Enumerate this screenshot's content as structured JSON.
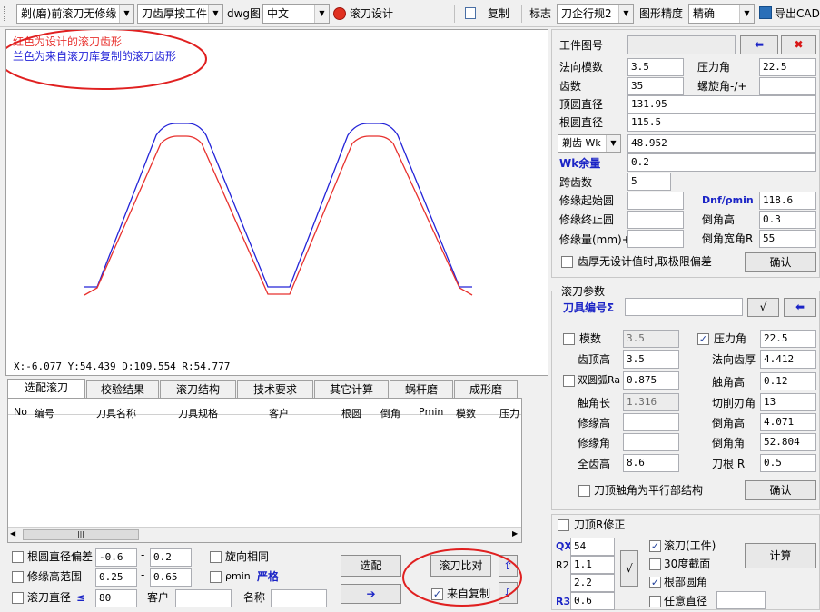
{
  "toolbar": {
    "mode_select": "剃(磨)前滚刀无修缘",
    "thickness_select": "刀齿厚按工件",
    "dwg_label": "dwg图",
    "lang_select": "中文",
    "design_label": "滚刀设计",
    "copy_label": "复制",
    "standard_label": "标志",
    "standard_select": "刀企行规2",
    "precision_label": "图形精度",
    "precision_select": "精确",
    "export_label": "导出CAD"
  },
  "canvas": {
    "legend_red": "红色为设计的滚刀齿形",
    "legend_blue": "兰色为来自滚刀库复制的滚刀齿形",
    "status": "X:-6.077  Y:54.439  D:109.554  R:54.777",
    "colors": {
      "red": "#e8312e",
      "blue": "#2323d8"
    }
  },
  "tabs": [
    "选配滚刀",
    "校验结果",
    "滚刀结构",
    "技术要求",
    "其它计算",
    "蜗杆磨",
    "成形磨"
  ],
  "table": {
    "columns": [
      "No",
      "编号",
      "刀具名称",
      "刀具规格",
      "客户",
      "根圆",
      "倒角",
      "Pmin",
      "模数",
      "压力"
    ],
    "rows": []
  },
  "filters": {
    "root_dev_label": "根圆直径偏差",
    "root_dev_min": "-0.6",
    "root_dev_max": "0.2",
    "same_rotation_label": "旋向相同",
    "mod_height_label": "修缘高范围",
    "mod_height_min": "0.25",
    "mod_height_max": "0.65",
    "rho_label": "ρmin",
    "strict_label": "严格",
    "hob_dia_label": "滚刀直径",
    "hob_dia_op": "≤",
    "hob_dia_value": "80",
    "customer_label": "客户",
    "customer_value": "",
    "name_label": "名称",
    "name_value": "",
    "dash": "-",
    "select_button": "选配",
    "compare_button": "滚刀比对",
    "from_copy_label": "来自复制"
  },
  "workpiece": {
    "drawing_no_label": "工件图号",
    "drawing_no": "",
    "normal_module_label": "法向模数",
    "normal_module": "3.5",
    "pressure_angle_label": "压力角",
    "pressure_angle": "22.5",
    "teeth_label": "齿数",
    "teeth": "35",
    "helix_label": "螺旋角-/+",
    "helix": "",
    "tip_dia_label": "顶圆直径",
    "tip_dia": "131.95",
    "root_dia_label": "根圆直径",
    "root_dia": "115.5",
    "wk_select": "剃齿 Wk",
    "wk_value": "48.952",
    "wk_allow_label": "Wk余量",
    "wk_allow": "0.2",
    "span_teeth_label": "跨齿数",
    "span_teeth": "5",
    "mod_start_label": "修缘起始圆",
    "mod_start": "",
    "dnf_label": "Dnf/ρmin",
    "dnf": "118.6",
    "mod_end_label": "修缘终止圆",
    "mod_end": "",
    "chamfer_h_label": "倒角高",
    "chamfer_h": "0.3",
    "mod_amount_label": "修缘量(mm)+",
    "mod_amount": "",
    "chamfer_w_label": "倒角宽角R",
    "chamfer_w": "55",
    "limit_dev_label": "齿厚无设计值时,取极限偏差",
    "confirm_label": "确认"
  },
  "hob": {
    "section_label": "滚刀参数",
    "tool_no_label": "刀具编号Σ",
    "tool_no": "",
    "module_label": "模数",
    "module": "3.5",
    "pressure_label": "压力角",
    "pressure": "22.5",
    "addendum_label": "齿顶高",
    "addendum": "3.5",
    "normal_thick_label": "法向齿厚",
    "normal_thick": "4.412",
    "double_arc_label": "双圆弧Ra",
    "double_arc": "0.875",
    "tip_height_label": "触角高",
    "tip_height": "0.12",
    "tip_len_label": "触角长",
    "tip_len": "1.316",
    "cut_angle_label": "切削刃角",
    "cut_angle": "13",
    "mod_h_label": "修缘高",
    "mod_h": "",
    "chamfer_h_label": "倒角高",
    "chamfer_h": "4.071",
    "mod_a_label": "修缘角",
    "mod_a": "",
    "chamfer_a_label": "倒角角",
    "chamfer_a": "52.804",
    "full_h_label": "全齿高",
    "full_h": "8.6",
    "root_r_label": "刀根 R",
    "root_r": "0.5",
    "parallel_label": "刀顶触角为平行部结构",
    "confirm_label": "确认"
  },
  "bottom": {
    "tip_r_label": "刀顶R修正",
    "qx_label": "QX",
    "qx": "54",
    "r2_label": "R2",
    "r2_a": "1.1",
    "r2_b": "2.2",
    "r3_label": "R3",
    "r3": "0.6",
    "hob_work_label": "滚刀(工件)",
    "section30_label": "30度截面",
    "root_round_label": "根部圆角",
    "any_dia_label": "任意直径",
    "any_dia": "",
    "calc_label": "计算"
  }
}
